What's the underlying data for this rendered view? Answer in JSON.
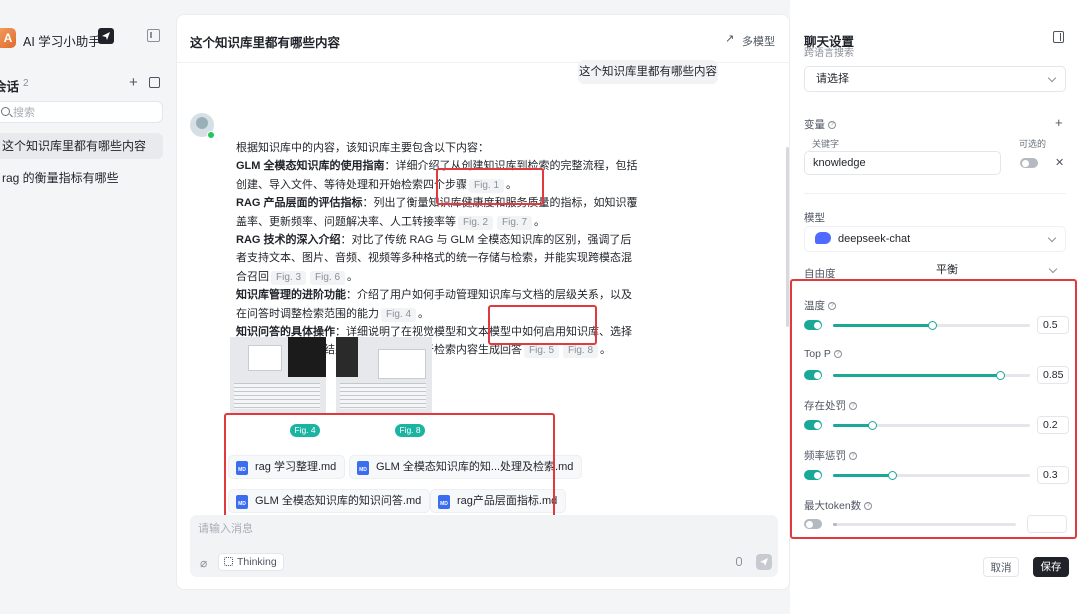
{
  "sidebar": {
    "logo_letter": "A",
    "app_title": "AI 学习小助手",
    "conversations_title": "会话",
    "conversations_count": "2",
    "search_placeholder": "搜索",
    "items": [
      {
        "label": "这个知识库里都有哪些内容",
        "active": true
      },
      {
        "label": "rag 的衡量指标有哪些",
        "active": false
      }
    ]
  },
  "chat": {
    "title": "这个知识库里都有哪些内容",
    "multi_model_label": "多模型",
    "user_message": "这个知识库里都有哪些内容",
    "answer": {
      "intro": "根据知识库中的内容，该知识库主要包含以下内容：",
      "p1_head": "GLM 全模态知识库的使用指南",
      "p1_text": "：详细介绍了从创建知识库到检索的完整流程，包括创建、导入文件、等待处理和开始检索四个步骤",
      "p1_figs": [
        "Fig. 1"
      ],
      "p2_head": "RAG 产品层面的评估指标",
      "p2_text": "：列出了衡量知识库健康度和服务质量的指标，如知识覆盖率、更新频率、问题解决率、人工转接率等",
      "p2_figs": [
        "Fig. 2",
        "Fig. 7"
      ],
      "p3_head": "RAG 技术的深入介绍",
      "p3_text": "：对比了传统 RAG 与 GLM 全模态知识库的区别，强调了后者支持文本、图片、音频、视频等多种格式的统一存储与检索，并能实现跨模态混合召回",
      "p3_figs": [
        "Fig. 3",
        "Fig. 6"
      ],
      "p4_head": "知识库管理的进阶功能",
      "p4_text": "：介绍了用户如何手动管理知识库与文档的层级关系，以及在问答时调整检索范围的能力",
      "p4_figs": [
        "Fig. 4"
      ],
      "p5_head": "知识问答的具体操作",
      "p5_text": "：详细说明了在视觉模型和文本模型中如何启用知识库、选择知识库、查看检索结果以及系统如何基于检索内容生成回答",
      "p5_figs": [
        "Fig. 5",
        "Fig. 8"
      ],
      "period": "。"
    },
    "images": [
      {
        "tag": "Fig. 4"
      },
      {
        "tag": "Fig. 8"
      }
    ],
    "files": [
      {
        "name": "rag 学习整理.md"
      },
      {
        "name": "GLM 全模态知识库的知...处理及检索.md"
      },
      {
        "name": "GLM 全模态知识库的知识问答.md"
      },
      {
        "name": "rag产品层面指标.md"
      }
    ],
    "input_placeholder": "请输入消息",
    "thinking_label": "Thinking"
  },
  "settings": {
    "title": "聊天设置",
    "cut_label": "跨语言搜索",
    "select_placeholder": "请选择",
    "variables_label": "变量",
    "keyword_header": "关键字",
    "optional_header": "可选的",
    "keyword_value": "knowledge",
    "model_label": "模型",
    "model_value": "deepseek-chat",
    "freedom_label": "自由度",
    "freedom_value": "平衡",
    "params": [
      {
        "label": "温度",
        "enabled": true,
        "value": "0.5",
        "fraction": 0.5
      },
      {
        "label": "Top P",
        "enabled": true,
        "value": "0.85",
        "fraction": 0.85
      },
      {
        "label": "存在处罚",
        "enabled": true,
        "value": "0.2",
        "fraction": 0.2
      },
      {
        "label": "频率惩罚",
        "enabled": true,
        "value": "0.3",
        "fraction": 0.3
      }
    ],
    "max_tokens_label": "最大token数",
    "cancel_label": "取消",
    "save_label": "保存"
  },
  "colors": {
    "accent": "#1aa898",
    "highlight_box": "#e0393e",
    "fig_tag": "#1bb3a2"
  }
}
